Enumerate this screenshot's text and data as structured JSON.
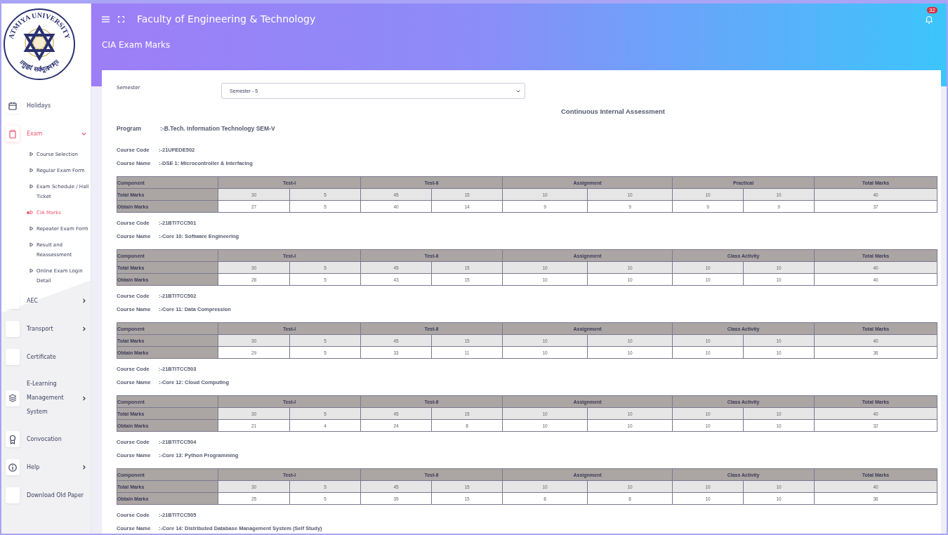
{
  "logo": {
    "text": "ATMIYA UNIVERSITY",
    "motto": "॥सुहृदं सर्वभूतानाम्॥"
  },
  "sidebar": {
    "items": [
      {
        "label": "Holidays",
        "kind": "link",
        "selected": false
      },
      {
        "label": "Exam",
        "kind": "group",
        "selected": true,
        "expanded": true,
        "children": [
          {
            "label": "Course Selection",
            "selected": false
          },
          {
            "label": "Regular Exam Form",
            "selected": false
          },
          {
            "label": "Exam Schedule / Hall Ticket",
            "selected": false
          },
          {
            "label": "CIA Marks",
            "selected": true
          },
          {
            "label": "Repeater Exam Form",
            "selected": false
          },
          {
            "label": "Result and Reassessment",
            "selected": false
          },
          {
            "label": "Online Exam Login Detail",
            "selected": false
          }
        ]
      },
      {
        "label": "AEC",
        "kind": "group",
        "selected": false,
        "expanded": false
      },
      {
        "label": "Transport",
        "kind": "group",
        "selected": false,
        "expanded": false
      },
      {
        "label": "Certificate",
        "kind": "link",
        "selected": false
      },
      {
        "label": "E-Learning Management System",
        "kind": "group",
        "selected": false,
        "expanded": false
      },
      {
        "label": "Convocation",
        "kind": "link",
        "selected": false
      },
      {
        "label": "Help",
        "kind": "group",
        "selected": false,
        "expanded": false
      },
      {
        "label": "Download Old Paper",
        "kind": "link",
        "selected": false
      }
    ]
  },
  "header": {
    "title": "Faculty of Engineering & Technology",
    "page_title": "CIA Exam Marks",
    "notification_count": "32"
  },
  "semester": {
    "label": "Semester",
    "value": "Semester - 5"
  },
  "report_title": "Continuous Internal Assessment",
  "program": {
    "label": "Program",
    "value": ":-B.Tech. Information Technology SEM-V"
  },
  "courses": [
    {
      "code_label": "Course Code",
      "code": ":-21UFEDE502",
      "name_label": "Course Name",
      "name": ":-DSE 1: Microcontroller & Interfacing",
      "groups": [
        "Component",
        "Test-I",
        "Test-II",
        "Assignment",
        "Practical",
        "Total Marks"
      ],
      "rows": [
        {
          "kind": "total",
          "label": "Total Marks",
          "cells": [
            "30",
            "5",
            "45",
            "15",
            "10",
            "10",
            "10",
            "10",
            "40"
          ]
        },
        {
          "kind": "obtain",
          "label": "Obtain Marks",
          "cells": [
            "27",
            "5",
            "40",
            "14",
            "9",
            "9",
            "9",
            "9",
            "37"
          ]
        }
      ]
    },
    {
      "code_label": "Course Code",
      "code": ":-21BTITCC501",
      "name_label": "Course Name",
      "name": ":-Core 10: Software Engineering",
      "groups": [
        "Component",
        "Test-I",
        "Test-II",
        "Assignment",
        "Class Activity",
        "Total Marks"
      ],
      "rows": [
        {
          "kind": "total",
          "label": "Total Marks",
          "cells": [
            "30",
            "5",
            "45",
            "15",
            "10",
            "10",
            "10",
            "10",
            "40"
          ]
        },
        {
          "kind": "obtain",
          "label": "Obtain Marks",
          "cells": [
            "28",
            "5",
            "43",
            "15",
            "10",
            "10",
            "10",
            "10",
            "40"
          ]
        }
      ]
    },
    {
      "code_label": "Course Code",
      "code": ":-21BTITCC502",
      "name_label": "Course Name",
      "name": ":-Core 11: Data Compression",
      "groups": [
        "Component",
        "Test-I",
        "Test-II",
        "Assignment",
        "Class Activity",
        "Total Marks"
      ],
      "rows": [
        {
          "kind": "total",
          "label": "Total Marks",
          "cells": [
            "30",
            "5",
            "45",
            "15",
            "10",
            "10",
            "10",
            "10",
            "40"
          ]
        },
        {
          "kind": "obtain",
          "label": "Obtain Marks",
          "cells": [
            "29",
            "5",
            "33",
            "11",
            "10",
            "10",
            "10",
            "10",
            "36"
          ]
        }
      ]
    },
    {
      "code_label": "Course Code",
      "code": ":-21BTITCC503",
      "name_label": "Course Name",
      "name": ":-Core 12: Cloud Computing",
      "groups": [
        "Component",
        "Test-I",
        "Test-II",
        "Assignment",
        "Class Activity",
        "Total Marks"
      ],
      "rows": [
        {
          "kind": "total",
          "label": "Total Marks",
          "cells": [
            "30",
            "5",
            "45",
            "15",
            "10",
            "10",
            "10",
            "10",
            "40"
          ]
        },
        {
          "kind": "obtain",
          "label": "Obtain Marks",
          "cells": [
            "21",
            "4",
            "24",
            "8",
            "10",
            "10",
            "10",
            "10",
            "32"
          ]
        }
      ]
    },
    {
      "code_label": "Course Code",
      "code": ":-21BTITCC504",
      "name_label": "Course Name",
      "name": ":-Core 13: Python Programming",
      "groups": [
        "Component",
        "Test-I",
        "Test-II",
        "Assignment",
        "Class Activity",
        "Total Marks"
      ],
      "rows": [
        {
          "kind": "total",
          "label": "Total Marks",
          "cells": [
            "30",
            "5",
            "45",
            "15",
            "10",
            "10",
            "10",
            "10",
            "40"
          ]
        },
        {
          "kind": "obtain",
          "label": "Obtain Marks",
          "cells": [
            "25",
            "5",
            "39",
            "15",
            "8",
            "8",
            "10",
            "10",
            "36"
          ]
        }
      ]
    },
    {
      "code_label": "Course Code",
      "code": ":-21BTITCC505",
      "name_label": "Course Name",
      "name": ":-Core 14: Distributed Database Management System (Self Study)"
    }
  ]
}
